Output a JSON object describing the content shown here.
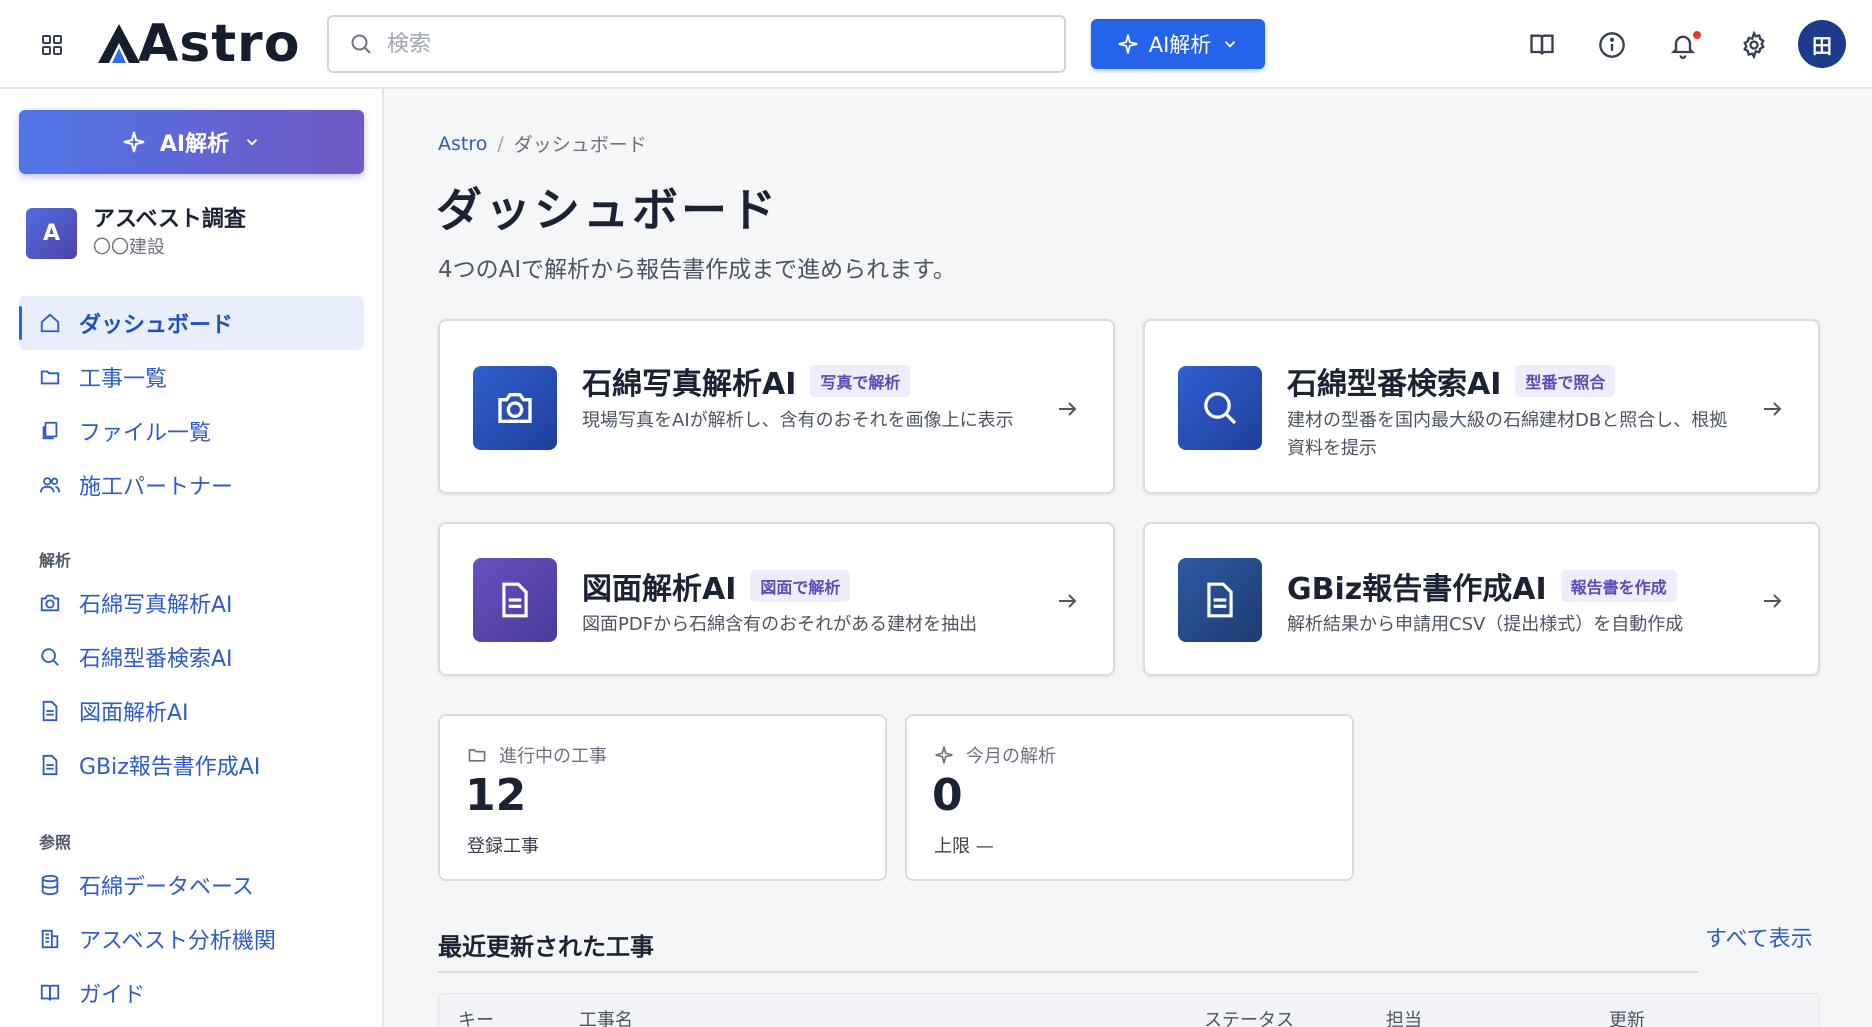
{
  "header": {
    "logo": "Astro",
    "search_placeholder": "検索",
    "ai_button": "AI解析",
    "avatar_initial": "田",
    "icons": [
      "grid-icon",
      "book-icon",
      "info-icon",
      "bell-icon",
      "gear-icon"
    ]
  },
  "sidebar": {
    "ai_button": "AI解析",
    "project": {
      "initial": "A",
      "name": "アスベスト調査",
      "company": "〇〇建設"
    },
    "nav_main": [
      {
        "label": "ダッシュボード",
        "icon": "home-icon",
        "active": true
      },
      {
        "label": "工事一覧",
        "icon": "folder-icon"
      },
      {
        "label": "ファイル一覧",
        "icon": "files-icon"
      },
      {
        "label": "施工パートナー",
        "icon": "users-icon"
      }
    ],
    "section_analysis": "解析",
    "nav_analysis": [
      {
        "label": "石綿写真解析AI",
        "icon": "camera-icon"
      },
      {
        "label": "石綿型番検索AI",
        "icon": "search-icon"
      },
      {
        "label": "図面解析AI",
        "icon": "document-icon"
      },
      {
        "label": "GBiz報告書作成AI",
        "icon": "document-icon"
      }
    ],
    "section_reference": "参照",
    "nav_reference": [
      {
        "label": "石綿データベース",
        "icon": "database-icon"
      },
      {
        "label": "アスベスト分析機関",
        "icon": "building-icon"
      },
      {
        "label": "ガイド",
        "icon": "book-icon"
      }
    ]
  },
  "main": {
    "breadcrumb": {
      "root": "Astro",
      "separator": "/",
      "current": "ダッシュボード"
    },
    "title": "ダッシュボード",
    "subtitle": "4つのAIで解析から報告書作成まで進められます。",
    "cards": [
      {
        "title": "石綿写真解析AI",
        "tag": "写真で解析",
        "desc": "現場写真をAIが解析し、含有のおそれを画像上に表示",
        "icon": "camera-icon"
      },
      {
        "title": "石綿型番検索AI",
        "tag": "型番で照合",
        "desc": "建材の型番を国内最大級の石綿建材DBと照合し、根拠資料を提示",
        "icon": "search-icon"
      },
      {
        "title": "図面解析AI",
        "tag": "図面で解析",
        "desc": "図面PDFから石綿含有のおそれがある建材を抽出",
        "icon": "document-icon"
      },
      {
        "title": "GBiz報告書作成AI",
        "tag": "報告書を作成",
        "desc": "解析結果から申請用CSV（提出様式）を自動作成",
        "icon": "document-icon"
      }
    ],
    "stats": [
      {
        "label": "進行中の工事",
        "value": "12",
        "sub": "登録工事",
        "icon": "folder-icon"
      },
      {
        "label": "今月の解析",
        "value": "0",
        "sub": "上限 —",
        "icon": "sparkle-icon"
      }
    ],
    "recent": {
      "title": "最近更新された工事",
      "see_all": "すべて表示",
      "columns": [
        "キー",
        "工事名",
        "ステータス",
        "担当",
        "更新"
      ]
    }
  },
  "colors": {
    "primary": "#2563eb",
    "nav_text": "#2e5bc7",
    "tag_text": "#5a4bb8"
  }
}
